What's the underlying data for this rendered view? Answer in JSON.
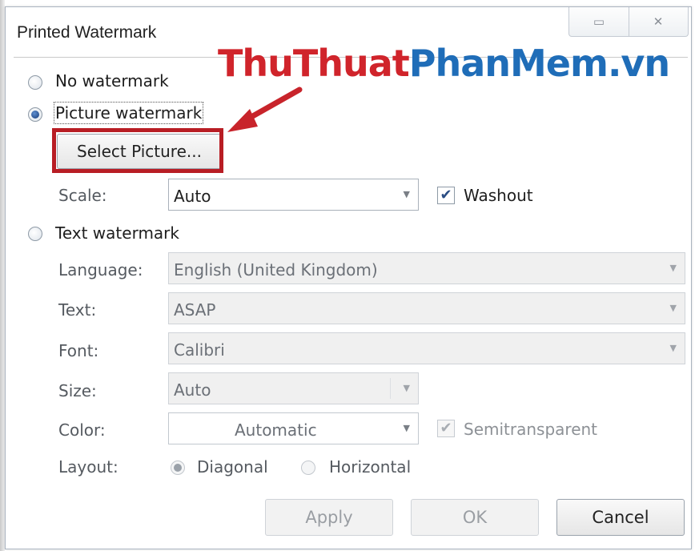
{
  "window": {
    "title": "Printed Watermark",
    "minimize_glyph": "▭",
    "close_glyph": "✕"
  },
  "options": {
    "no_watermark": "No watermark",
    "picture_watermark": "Picture watermark",
    "select_picture_button": "Select Picture...",
    "scale_label": "Scale:",
    "scale_value": "Auto",
    "washout_label": "Washout",
    "washout_checked": true,
    "text_watermark": "Text watermark",
    "selected": "picture_watermark"
  },
  "text_settings": {
    "language_label": "Language:",
    "language_value": "English (United Kingdom)",
    "text_label": "Text:",
    "text_value": "ASAP",
    "font_label": "Font:",
    "font_value": "Calibri",
    "size_label": "Size:",
    "size_value": "Auto",
    "color_label": "Color:",
    "color_value": "Automatic",
    "semitransparent_label": "Semitransparent",
    "semitransparent_checked": true,
    "layout_label": "Layout:",
    "layout_diagonal": "Diagonal",
    "layout_horizontal": "Horizontal",
    "layout_selected": "diagonal"
  },
  "buttons": {
    "apply": "Apply",
    "ok": "OK",
    "cancel": "Cancel"
  },
  "overlay": {
    "logo_part1": "ThuThuat",
    "logo_part2": "PhanMem.vn",
    "logo_color1": "#d0242b",
    "logo_color2": "#1f6db8",
    "highlight_color": "#b81d24",
    "arrow_icon": "red-arrow-icon"
  }
}
